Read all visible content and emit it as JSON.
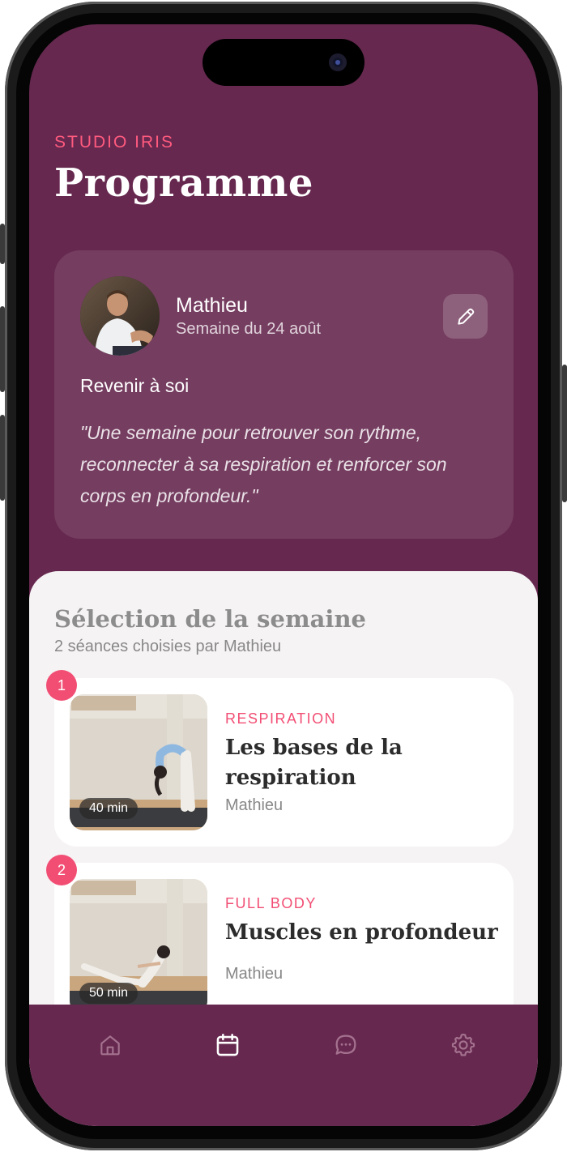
{
  "header": {
    "brand": "STUDIO IRIS",
    "title": "Programme"
  },
  "coach_card": {
    "name": "Mathieu",
    "week": "Semaine du 24 août",
    "subtitle": "Revenir à soi",
    "quote": "\"Une semaine pour retrouver son rythme, reconnecter à sa respiration et renforcer son corps en profondeur.\"",
    "edit_icon": "pencil-icon"
  },
  "selection": {
    "title": "Sélection de la semaine",
    "subtitle": "2 séances choisies par Mathieu",
    "sessions": [
      {
        "number": "1",
        "duration": "40 min",
        "category": "RESPIRATION",
        "title": "Les bases de la respiration",
        "author": "Mathieu"
      },
      {
        "number": "2",
        "duration": "50 min",
        "category": "FULL BODY",
        "title": "Muscles en profondeur",
        "author": "Mathieu"
      }
    ]
  },
  "navbar": {
    "items": [
      {
        "icon": "home-icon",
        "active": false
      },
      {
        "icon": "calendar-icon",
        "active": true
      },
      {
        "icon": "chat-icon",
        "active": false
      },
      {
        "icon": "settings-icon",
        "active": false
      }
    ]
  },
  "colors": {
    "background": "#66284f",
    "accent": "#f24e74",
    "sheet": "#f6f3f5"
  }
}
